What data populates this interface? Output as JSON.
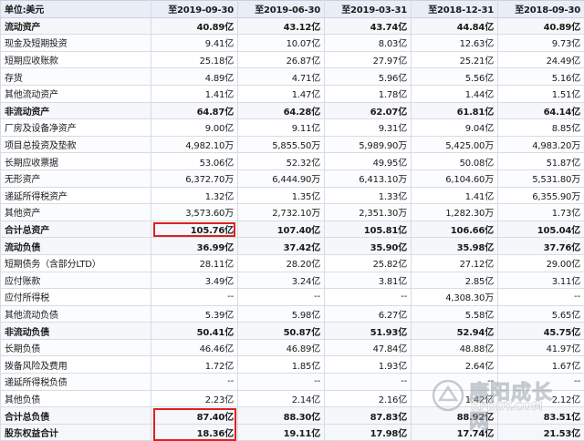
{
  "table": {
    "header": {
      "unit_label": "单位:美元",
      "periods": [
        "至2019-09-30",
        "至2019-06-30",
        "至2019-03-31",
        "至2018-12-31",
        "至2018-09-30"
      ]
    },
    "rows": [
      {
        "label": "流动资产",
        "bold": true,
        "values": [
          "40.89亿",
          "43.12亿",
          "43.74亿",
          "44.84亿",
          "40.89亿"
        ]
      },
      {
        "label": "现金及短期投资",
        "values": [
          "9.41亿",
          "10.07亿",
          "8.03亿",
          "12.63亿",
          "9.73亿"
        ]
      },
      {
        "label": "短期应收账款",
        "values": [
          "25.18亿",
          "26.87亿",
          "27.97亿",
          "25.21亿",
          "24.49亿"
        ]
      },
      {
        "label": "存货",
        "values": [
          "4.89亿",
          "4.71亿",
          "5.96亿",
          "5.56亿",
          "5.16亿"
        ]
      },
      {
        "label": "其他流动资产",
        "values": [
          "1.41亿",
          "1.47亿",
          "1.78亿",
          "1.44亿",
          "1.51亿"
        ]
      },
      {
        "label": "非流动资产",
        "bold": true,
        "values": [
          "64.87亿",
          "64.28亿",
          "62.07亿",
          "61.81亿",
          "64.14亿"
        ]
      },
      {
        "label": "厂房及设备净资产",
        "values": [
          "9.00亿",
          "9.11亿",
          "9.31亿",
          "9.04亿",
          "8.85亿"
        ]
      },
      {
        "label": "项目总投资及垫款",
        "values": [
          "4,982.10万",
          "5,855.50万",
          "5,989.90万",
          "5,425.00万",
          "4,983.20万"
        ]
      },
      {
        "label": "长期应收票据",
        "values": [
          "53.06亿",
          "52.32亿",
          "49.95亿",
          "50.08亿",
          "51.87亿"
        ]
      },
      {
        "label": "无形资产",
        "values": [
          "6,372.70万",
          "6,444.90万",
          "6,413.10万",
          "6,104.60万",
          "5,531.80万"
        ]
      },
      {
        "label": "递延所得税资产",
        "values": [
          "1.32亿",
          "1.35亿",
          "1.33亿",
          "1.41亿",
          "6,355.90万"
        ]
      },
      {
        "label": "其他资产",
        "values": [
          "3,573.60万",
          "2,732.10万",
          "2,351.30万",
          "1,282.30万",
          "1.73亿"
        ]
      },
      {
        "label": "合计总资产",
        "bold": true,
        "highlight": true,
        "values": [
          "105.76亿",
          "107.40亿",
          "105.81亿",
          "106.66亿",
          "105.04亿"
        ]
      },
      {
        "label": "流动负债",
        "bold": true,
        "values": [
          "36.99亿",
          "37.42亿",
          "35.90亿",
          "35.98亿",
          "37.76亿"
        ]
      },
      {
        "label": "短期债务（含部分LTD）",
        "values": [
          "28.11亿",
          "28.20亿",
          "25.82亿",
          "27.12亿",
          "29.00亿"
        ]
      },
      {
        "label": "应付账款",
        "values": [
          "3.49亿",
          "3.24亿",
          "3.81亿",
          "2.85亿",
          "3.11亿"
        ]
      },
      {
        "label": "应付所得税",
        "values": [
          "--",
          "--",
          "--",
          "4,308.30万",
          "--"
        ]
      },
      {
        "label": "其他流动负债",
        "values": [
          "5.39亿",
          "5.98亿",
          "6.27亿",
          "5.58亿",
          "5.65亿"
        ]
      },
      {
        "label": "非流动负债",
        "bold": true,
        "values": [
          "50.41亿",
          "50.87亿",
          "51.93亿",
          "52.94亿",
          "45.75亿"
        ]
      },
      {
        "label": "长期负债",
        "values": [
          "46.46亿",
          "46.89亿",
          "47.84亿",
          "48.88亿",
          "41.97亿"
        ]
      },
      {
        "label": "拨备风险及费用",
        "values": [
          "1.72亿",
          "1.85亿",
          "1.93亿",
          "2.64亿",
          "1.67亿"
        ]
      },
      {
        "label": "递延所得税负债",
        "values": [
          "--",
          "--",
          "--",
          "--",
          "--"
        ]
      },
      {
        "label": "其他负债",
        "values": [
          "2.23亿",
          "2.14亿",
          "2.16亿",
          "1.42亿",
          "2.12亿"
        ]
      },
      {
        "label": "合计总负债",
        "bold": true,
        "highlight": true,
        "values": [
          "87.40亿",
          "88.30亿",
          "87.83亿",
          "88.92亿",
          "83.51亿"
        ]
      },
      {
        "label": "股东权益合计",
        "bold": true,
        "highlight": true,
        "values": [
          "18.36亿",
          "19.11亿",
          "17.98亿",
          "17.74亿",
          "21.53亿"
        ]
      }
    ]
  },
  "watermark": {
    "text": "康阳成长网",
    "url": "KFDDY.COM"
  },
  "colors": {
    "highlight_border": "#e02020",
    "header_bg": "#e9eef6",
    "grid": "#d6dce6"
  }
}
